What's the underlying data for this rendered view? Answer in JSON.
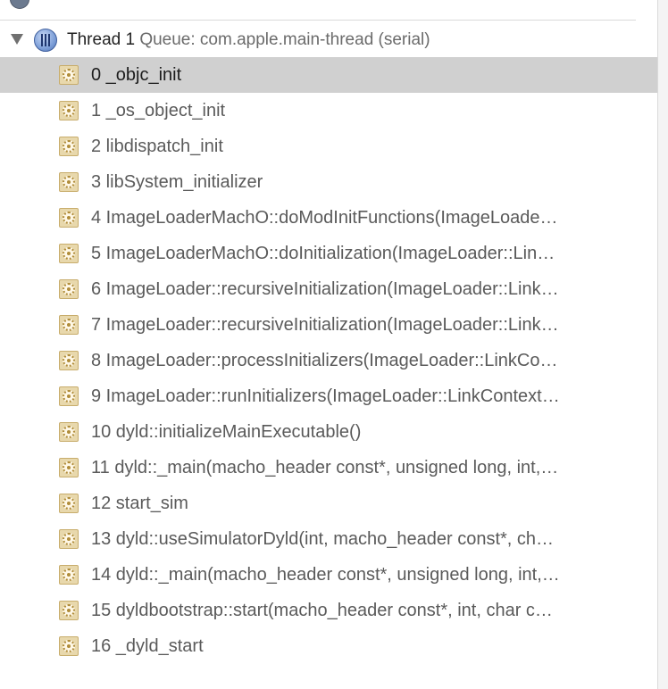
{
  "thread": {
    "name": "Thread 1",
    "queue": "Queue: com.apple.main-thread (serial)",
    "icon": "thread-icon"
  },
  "frames": [
    {
      "label": "0 _objc_init",
      "selected": true
    },
    {
      "label": "1 _os_object_init"
    },
    {
      "label": "2 libdispatch_init"
    },
    {
      "label": "3 libSystem_initializer"
    },
    {
      "label": "4 ImageLoaderMachO::doModInitFunctions(ImageLoade…"
    },
    {
      "label": "5 ImageLoaderMachO::doInitialization(ImageLoader::Lin…"
    },
    {
      "label": "6 ImageLoader::recursiveInitialization(ImageLoader::Link…"
    },
    {
      "label": "7 ImageLoader::recursiveInitialization(ImageLoader::Link…"
    },
    {
      "label": "8 ImageLoader::processInitializers(ImageLoader::LinkCo…"
    },
    {
      "label": "9 ImageLoader::runInitializers(ImageLoader::LinkContext…"
    },
    {
      "label": "10 dyld::initializeMainExecutable()"
    },
    {
      "label": "11 dyld::_main(macho_header const*, unsigned long, int,…"
    },
    {
      "label": "12 start_sim"
    },
    {
      "label": "13 dyld::useSimulatorDyld(int, macho_header const*, ch…"
    },
    {
      "label": "14 dyld::_main(macho_header const*, unsigned long, int,…"
    },
    {
      "label": "15 dyldbootstrap::start(macho_header const*, int, char c…"
    },
    {
      "label": "16 _dyld_start"
    }
  ],
  "colors": {
    "selection": "#d0d0d0",
    "frame_icon": "#e8d8ac"
  }
}
